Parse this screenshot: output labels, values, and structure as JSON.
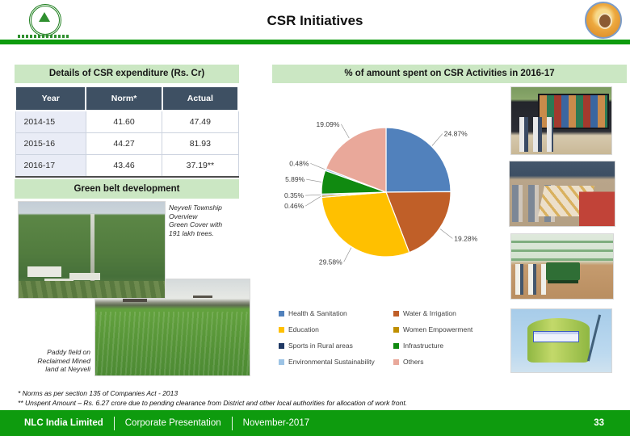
{
  "header": {
    "title": "CSR Initiatives"
  },
  "theme": {
    "accent_green": "#0E9B0E",
    "panel_green": "#CBE7C3",
    "table_header": "#3E5063"
  },
  "left_panel": {
    "table_title": "Details of CSR expenditure (Rs. Cr)",
    "table": {
      "columns": [
        "Year",
        "Norm*",
        "Actual"
      ],
      "rows": [
        [
          "2014-15",
          "41.60",
          "47.49"
        ],
        [
          "2015-16",
          "44.27",
          "81.93"
        ],
        [
          "2016-17",
          "43.46",
          "37.19**"
        ]
      ]
    },
    "green_belt_title": "Green belt development",
    "township_caption": "Neyveli Township\nOverview\nGreen Cover with\n191 lakh trees.",
    "paddy_caption": "Paddy field on\nReclaimed Mined\nland at Neyveli"
  },
  "chart_data": {
    "type": "pie",
    "title": "% of amount spent on CSR Activities in 2016-17",
    "labels": "percent",
    "legend_position": "bottom",
    "series": [
      {
        "name": "Health & Sanitation",
        "value": 24.87,
        "color": "#5181BC"
      },
      {
        "name": "Water & Irrigation",
        "value": 19.28,
        "color": "#C05F28"
      },
      {
        "name": "Education",
        "value": 29.58,
        "color": "#FFC000"
      },
      {
        "name": "Women Empowerment",
        "value": 0.46,
        "color": "#BF8F00"
      },
      {
        "name": "Sports in Rural areas",
        "value": 0.35,
        "color": "#1F3864"
      },
      {
        "name": "Infrastructure",
        "value": 5.89,
        "color": "#108A10"
      },
      {
        "name": "Environmental Sustainability",
        "value": 0.48,
        "color": "#9CC3E5"
      },
      {
        "name": "Others",
        "value": 19.09,
        "color": "#E9A89A"
      }
    ]
  },
  "footnotes": [
    "* Norms as per section 135 of Companies Act - 2013",
    "** Unspent Amount – Rs. 6.27 crore due to pending clearance from District and other local authorities for allocation of work front."
  ],
  "footer": {
    "company": "NLC India Limited",
    "presentation": "Corporate Presentation",
    "date": "November-2017",
    "page": "33"
  }
}
